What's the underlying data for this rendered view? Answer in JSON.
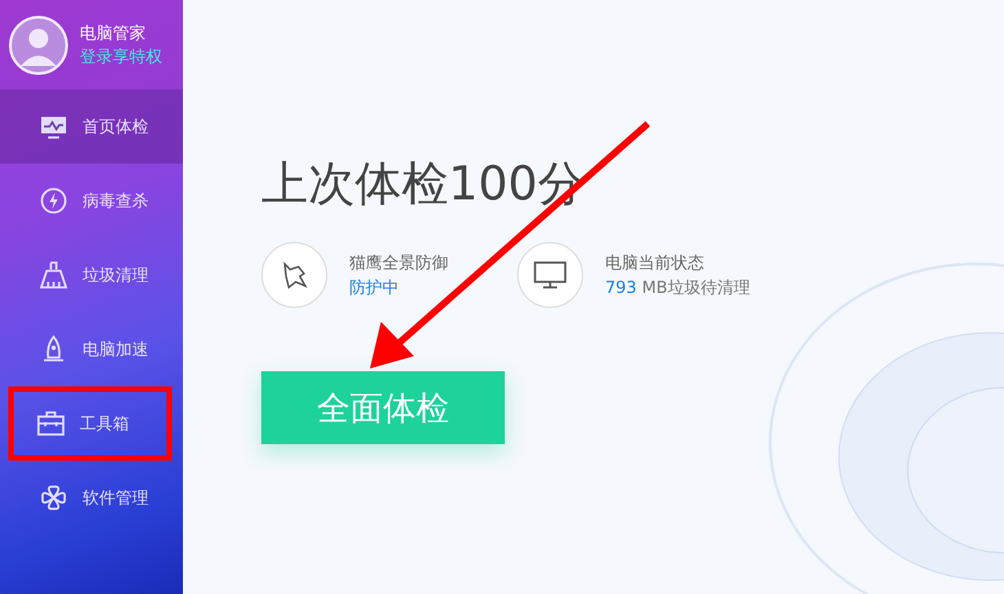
{
  "profile": {
    "name": "电脑管家",
    "login_link": "登录享特权"
  },
  "nav": [
    {
      "label": "首页体检",
      "selected": true,
      "highlighted": false
    },
    {
      "label": "病毒查杀",
      "selected": false,
      "highlighted": false
    },
    {
      "label": "垃圾清理",
      "selected": false,
      "highlighted": false
    },
    {
      "label": "电脑加速",
      "selected": false,
      "highlighted": false
    },
    {
      "label": "工具箱",
      "selected": false,
      "highlighted": true
    },
    {
      "label": "软件管理",
      "selected": false,
      "highlighted": false
    }
  ],
  "headline": "上次体检100分",
  "defense": {
    "title": "猫鹰全景防御",
    "status": "防护中"
  },
  "pc_status": {
    "title": "电脑当前状态",
    "junk_size": "793",
    "junk_text": "MB垃圾待清理"
  },
  "scan_button": "全面体检"
}
